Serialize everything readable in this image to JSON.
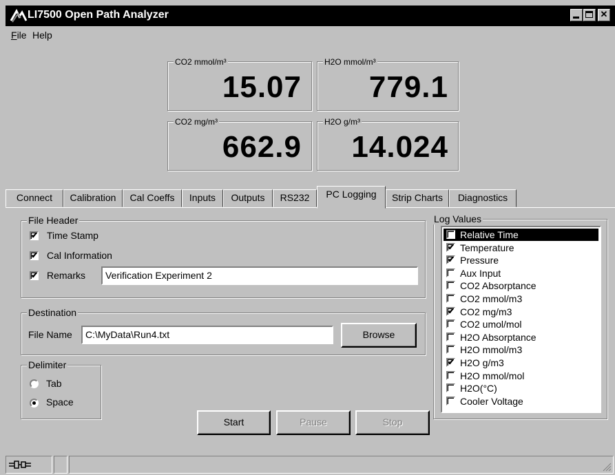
{
  "window": {
    "title": "LI7500 Open Path Analyzer"
  },
  "menu": [
    {
      "label": "File",
      "accel": "F"
    },
    {
      "label": "Help",
      "accel": ""
    }
  ],
  "readouts": [
    {
      "label": "CO2 mmol/m³",
      "value": "15.07"
    },
    {
      "label": "H2O mmol/m³",
      "value": "779.1"
    },
    {
      "label": "CO2 mg/m³",
      "value": "662.9"
    },
    {
      "label": "H2O g/m³",
      "value": "14.024"
    }
  ],
  "tabs": [
    {
      "label": "Connect"
    },
    {
      "label": "Calibration"
    },
    {
      "label": "Cal Coeffs"
    },
    {
      "label": "Inputs"
    },
    {
      "label": "Outputs"
    },
    {
      "label": "RS232"
    },
    {
      "label": "PC Logging",
      "active": true
    },
    {
      "label": "Strip Charts"
    },
    {
      "label": "Diagnostics"
    }
  ],
  "file_header": {
    "legend": "File Header",
    "time_stamp": {
      "label": "Time Stamp",
      "checked": true
    },
    "cal_information": {
      "label": "Cal Information",
      "checked": true
    },
    "remarks": {
      "label": "Remarks",
      "checked": true,
      "value": "Verification Experiment 2"
    }
  },
  "destination": {
    "legend": "Destination",
    "file_name_label": "File Name",
    "file_name_value": "C:\\MyData\\Run4.txt",
    "browse_label": "Browse"
  },
  "delimiter": {
    "legend": "Delimiter",
    "options": [
      {
        "label": "Tab",
        "selected": false
      },
      {
        "label": "Space",
        "selected": true
      }
    ]
  },
  "buttons": {
    "start": "Start",
    "pause": "Pause",
    "stop": "Stop"
  },
  "log_values": {
    "legend": "Log Values",
    "items": [
      {
        "label": "Relative Time",
        "checked": false,
        "selected": true
      },
      {
        "label": "Temperature",
        "checked": true
      },
      {
        "label": "Pressure",
        "checked": true
      },
      {
        "label": "Aux Input",
        "checked": false
      },
      {
        "label": "CO2 Absorptance",
        "checked": false
      },
      {
        "label": "CO2 mmol/m3",
        "checked": false
      },
      {
        "label": "CO2 mg/m3",
        "checked": true
      },
      {
        "label": "CO2 umol/mol",
        "checked": false
      },
      {
        "label": "H2O Absorptance",
        "checked": false
      },
      {
        "label": "H2O mmol/m3",
        "checked": false
      },
      {
        "label": "H2O g/m3",
        "checked": true
      },
      {
        "label": "H2O mmol/mol",
        "checked": false
      },
      {
        "label": "H2O(°C)",
        "checked": false
      },
      {
        "label": "Cooler Voltage",
        "checked": false
      }
    ]
  },
  "icons": {
    "app": "licor-logo-icon",
    "status": "plug-icon",
    "minimize": "minimize-icon",
    "maximize": "maximize-icon",
    "close": "close-icon"
  }
}
